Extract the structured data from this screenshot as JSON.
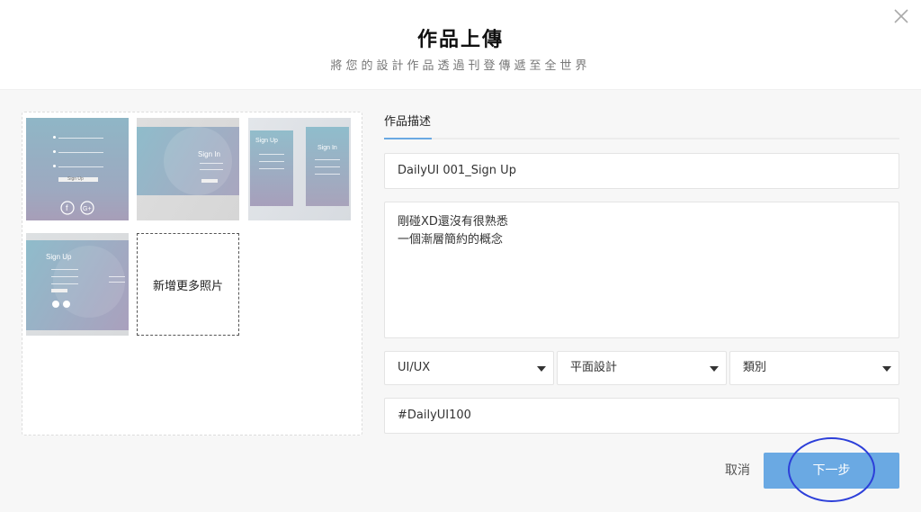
{
  "header": {
    "title": "作品上傳",
    "subtitle": "將您的設計作品透過刊登傳遞至全世界",
    "close_icon": "close-icon"
  },
  "gallery": {
    "thumbnails": [
      {
        "sign_label": "Sign Up"
      },
      {
        "sign_label": "Sign In"
      },
      {
        "sign_label_left": "Sign Up",
        "sign_label_right": "Sign In"
      },
      {
        "sign_label": "Sign Up"
      }
    ],
    "add_more_label": "新增更多照片"
  },
  "form": {
    "tab_label": "作品描述",
    "title_value": "DailyUI  001_Sign Up",
    "description_value": "剛碰XD還沒有很熟悉\n一個漸層簡約的概念",
    "select_category": "UI/UX",
    "select_subcategory": "平面設計",
    "select_type": "類別",
    "tags_value": "#DailyUI100"
  },
  "actions": {
    "cancel_label": "取消",
    "next_label": "下一步"
  },
  "colors": {
    "accent": "#6aa9e3",
    "annotation_circle": "#2c3fd9"
  }
}
